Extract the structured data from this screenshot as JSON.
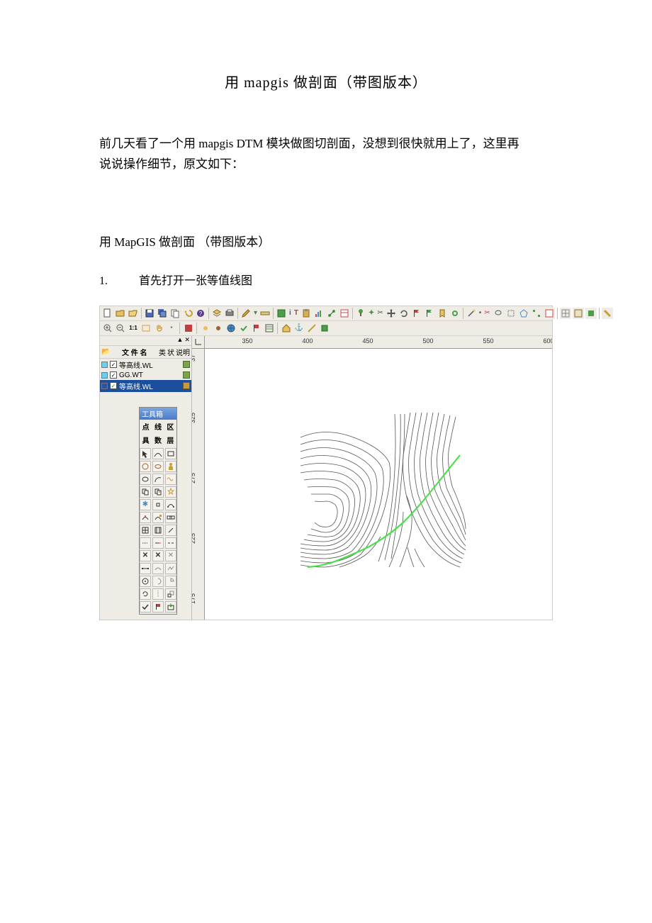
{
  "title": "用 mapgis 做剖面（带图版本）",
  "intro_line1": "前几天看了一个用 mapgis DTM 模块做图切剖面，没想到很快就用上了，这里再",
  "intro_line2": "说说操作细节，原文如下：",
  "section_header": "用 MapGIS 做剖面 （带图版本）",
  "step1_num": "1.",
  "step1_text": "首先打开一张等值线图",
  "ui": {
    "panel_close": "▲ ✕",
    "layer_header_icon": "📂",
    "layer_header_name": "文 件 名",
    "layer_header_col2": "类",
    "layer_header_col3": "状",
    "layer_header_col4": "说明",
    "layer1_name": "等高线.WL",
    "layer2_name": "GG.WT",
    "layer3_name": "等高线.WL",
    "check_mark": "✓",
    "toolbox_title": "工具箱",
    "toolbox_g1": "点",
    "toolbox_g2": "线",
    "toolbox_g3": "区",
    "toolbox_g4": "具",
    "toolbox_g5": "数",
    "toolbox_g6": "层"
  },
  "ruler_h": [
    "350",
    "400",
    "450",
    "500",
    "550",
    "600"
  ],
  "ruler_v": [
    "37",
    "325",
    "275",
    "225",
    "175"
  ]
}
